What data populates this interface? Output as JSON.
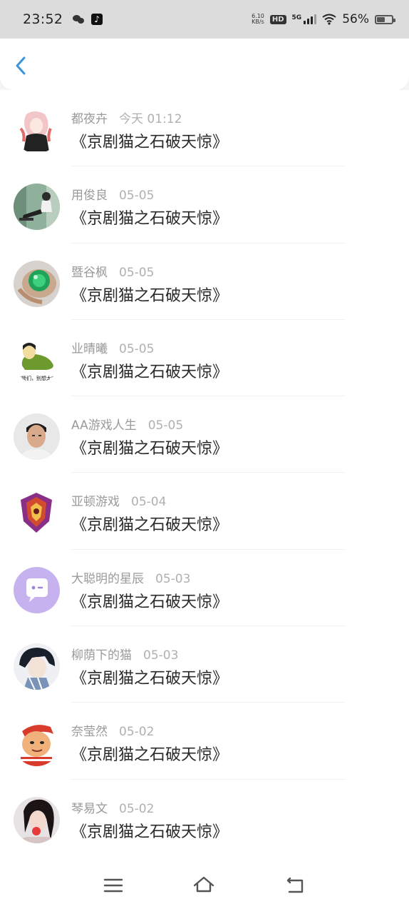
{
  "status_bar": {
    "time": "23:52",
    "net_speed_value": "6.10",
    "net_speed_unit": "KB/s",
    "hd": "HD",
    "network": "5G",
    "battery": "56%",
    "battery_level": 0.56
  },
  "header": {
    "back_icon": "chevron-left-icon",
    "accent_color": "#3a95dd"
  },
  "items": [
    {
      "name": "都夜卉",
      "date": "今天 01:12",
      "title": "《京剧猫之石破天惊》"
    },
    {
      "name": "用俊良",
      "date": "05-05",
      "title": "《京剧猫之石破天惊》"
    },
    {
      "name": "暨谷枫",
      "date": "05-05",
      "title": "《京剧猫之石破天惊》"
    },
    {
      "name": "业晴曦",
      "date": "05-05",
      "title": "《京剧猫之石破天惊》"
    },
    {
      "name": "AA游戏人生",
      "date": "05-05",
      "title": "《京剧猫之石破天惊》"
    },
    {
      "name": "亚顿游戏",
      "date": "05-04",
      "title": "《京剧猫之石破天惊》"
    },
    {
      "name": "大聪明的星辰",
      "date": "05-03",
      "title": "《京剧猫之石破天惊》"
    },
    {
      "name": "柳荫下的猫",
      "date": "05-03",
      "title": "《京剧猫之石破天惊》"
    },
    {
      "name": "奈莹然",
      "date": "05-02",
      "title": "《京剧猫之石破天惊》"
    },
    {
      "name": "琴易文",
      "date": "05-02",
      "title": "《京剧猫之石破天惊》"
    }
  ],
  "avatar_caption": "\"锁们，别想太\"",
  "nav": {
    "menu_icon": "menu-icon",
    "home_icon": "home-icon",
    "back_icon": "back-icon"
  }
}
